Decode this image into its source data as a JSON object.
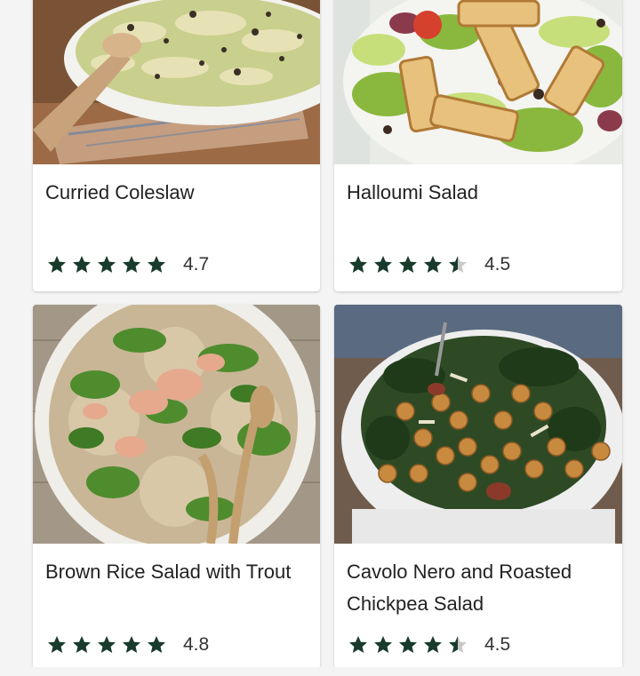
{
  "colors": {
    "star_filled": "#183b2c",
    "star_empty": "#c8c8c8",
    "title_text": "#222222",
    "rating_text": "#333333",
    "page_bg": "#f4f4f4"
  },
  "recipes": [
    {
      "title": "Curried Coleslaw",
      "rating": 4.7,
      "rating_label": "4.7",
      "stars": [
        1,
        1,
        1,
        1,
        1
      ],
      "image_icon": "coleslaw-photo"
    },
    {
      "title": "Halloumi Salad",
      "rating": 4.5,
      "rating_label": "4.5",
      "stars": [
        1,
        1,
        1,
        1,
        0.5
      ],
      "image_icon": "halloumi-salad-photo"
    },
    {
      "title": "Brown Rice Salad with Trout",
      "rating": 4.8,
      "rating_label": "4.8",
      "stars": [
        1,
        1,
        1,
        1,
        1
      ],
      "image_icon": "rice-trout-salad-photo"
    },
    {
      "title": "Cavolo Nero and Roasted Chickpea Salad",
      "rating": 4.5,
      "rating_label": "4.5",
      "stars": [
        1,
        1,
        1,
        1,
        0.5
      ],
      "image_icon": "chickpea-kale-salad-photo"
    }
  ]
}
